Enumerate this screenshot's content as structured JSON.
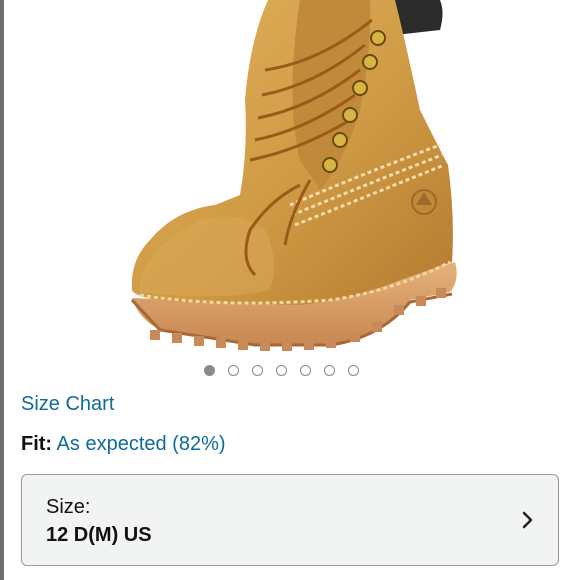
{
  "product": {
    "image_icon": "boot-image"
  },
  "carousel": {
    "count": 7,
    "active_index": 0
  },
  "links": {
    "size_chart": "Size Chart"
  },
  "fit": {
    "label": "Fit:",
    "value": "As expected (82%)"
  },
  "size_selector": {
    "label": "Size:",
    "value": "12 D(M) US",
    "icon": "chevron-right-icon"
  },
  "colors": {
    "link": "#0f6a9c",
    "box_bg": "#f2f3f3",
    "box_border": "#9a9a9a"
  }
}
